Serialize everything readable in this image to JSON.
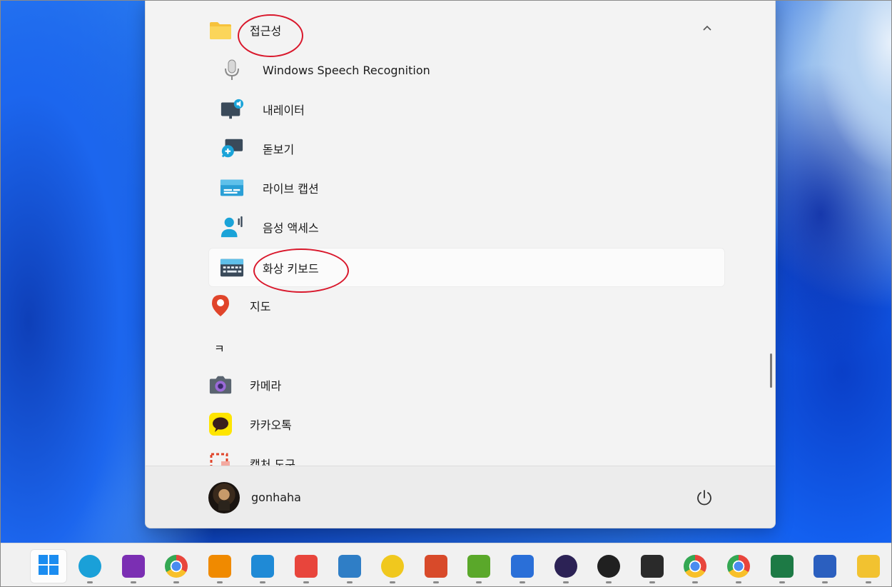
{
  "start_menu": {
    "folder": {
      "label": "접근성",
      "expanded": true
    },
    "folder_items": [
      {
        "label": "Windows Speech Recognition",
        "icon": "microphone-icon"
      },
      {
        "label": "내레이터",
        "icon": "narrator-icon"
      },
      {
        "label": "돋보기",
        "icon": "magnifier-icon"
      },
      {
        "label": "라이브 캡션",
        "icon": "live-captions-icon"
      },
      {
        "label": "음성 액세스",
        "icon": "voice-access-icon"
      },
      {
        "label": "화상 키보드",
        "icon": "onscreen-keyboard-icon",
        "highlighted": true
      }
    ],
    "apps_after": [
      {
        "label": "지도",
        "icon": "maps-pin-icon"
      }
    ],
    "letter_header": "ㅋ",
    "apps_k": [
      {
        "label": "카메라",
        "icon": "camera-icon"
      },
      {
        "label": "카카오톡",
        "icon": "kakaotalk-icon"
      },
      {
        "label": "캡처 도구",
        "icon": "snipping-tool-icon"
      }
    ],
    "user": {
      "name": "gonhaha"
    },
    "power_icon": "power-icon"
  },
  "taskbar": {
    "items": [
      {
        "name": "start",
        "icon": "windows-start-icon",
        "color": "#1a8cf0"
      },
      {
        "name": "edge",
        "icon": "edge-icon",
        "color": "#1aa0d8"
      },
      {
        "name": "onenote",
        "icon": "onenote-icon",
        "color": "#7b2fb3"
      },
      {
        "name": "chrome",
        "icon": "chrome-icon",
        "color": "#e8453c"
      },
      {
        "name": "search-tool",
        "icon": "magnifier-orange-icon",
        "color": "#f08a00"
      },
      {
        "name": "vscode",
        "icon": "vscode-icon",
        "color": "#1f8ad6"
      },
      {
        "name": "app-arrows",
        "icon": "arrows-app-icon",
        "color": "#e8453c"
      },
      {
        "name": "hangul",
        "icon": "hangul-icon",
        "color": "#2f7ec6"
      },
      {
        "name": "audio-app",
        "icon": "waveform-icon",
        "color": "#f0c81e"
      },
      {
        "name": "stripes-app",
        "icon": "stripes-app-icon",
        "color": "#d84a2a"
      },
      {
        "name": "notepad",
        "icon": "notepad-icon",
        "color": "#5aa82a"
      },
      {
        "name": "ai-app",
        "icon": "ai-app-icon",
        "color": "#2a6fd8"
      },
      {
        "name": "eclipse",
        "icon": "eclipse-icon",
        "color": "#2c2255"
      },
      {
        "name": "obs",
        "icon": "obs-icon",
        "color": "#202020"
      },
      {
        "name": "sticky-notes",
        "icon": "sticky-notes-icon",
        "color": "#2a2a2a"
      },
      {
        "name": "chrome-profile-1",
        "icon": "chrome-icon",
        "color": "#e8453c"
      },
      {
        "name": "chrome-profile-2",
        "icon": "chrome-icon",
        "color": "#e8453c"
      },
      {
        "name": "excel",
        "icon": "excel-icon",
        "color": "#1d7a45"
      },
      {
        "name": "word",
        "icon": "word-icon",
        "color": "#2b5fbf"
      },
      {
        "name": "file-explorer",
        "icon": "folder-icon",
        "color": "#f2c230"
      }
    ]
  },
  "colors": {
    "annotation": "#d9182c",
    "menu_bg": "#f3f3f3"
  }
}
